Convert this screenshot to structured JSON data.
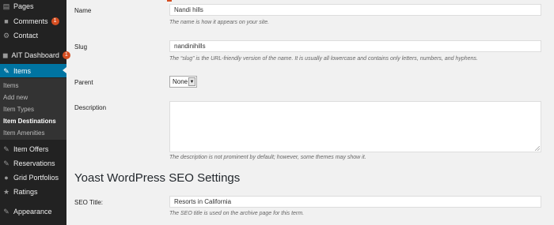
{
  "sidebar": {
    "items": [
      {
        "label": "Pages",
        "icon": "pages-icon"
      },
      {
        "label": "Comments",
        "icon": "comments-icon",
        "badge": "1"
      },
      {
        "label": "Contact",
        "icon": "contact-icon"
      },
      {
        "label": "AIT Dashboard",
        "icon": "ait-dashboard-icon",
        "badge": "1"
      },
      {
        "label": "Items",
        "icon": "items-icon",
        "active": true
      },
      {
        "label": "Item Offers",
        "icon": "item-offers-icon"
      },
      {
        "label": "Reservations",
        "icon": "reservations-icon"
      },
      {
        "label": "Grid Portfolios",
        "icon": "grid-portfolios-icon"
      },
      {
        "label": "Ratings",
        "icon": "ratings-icon"
      },
      {
        "label": "Appearance",
        "icon": "appearance-icon"
      }
    ],
    "submenu": [
      {
        "label": "Items"
      },
      {
        "label": "Add new"
      },
      {
        "label": "Item Types"
      },
      {
        "label": "Item Destinations",
        "current": true
      },
      {
        "label": "Item Amenities"
      }
    ]
  },
  "form": {
    "name": {
      "label": "Name",
      "value": "Nandi hills",
      "help": "The name is how it appears on your site."
    },
    "slug": {
      "label": "Slug",
      "value": "nandinihills",
      "help": "The “slug” is the URL-friendly version of the name. It is usually all lowercase and contains only letters, numbers, and hyphens."
    },
    "parent": {
      "label": "Parent",
      "selected": "None"
    },
    "description": {
      "label": "Description",
      "value": "",
      "help": "The description is not prominent by default; however, some themes may show it."
    },
    "section_title": "Yoast WordPress SEO Settings",
    "seo_title": {
      "label": "SEO Title:",
      "value": "Resorts in California",
      "help": "The SEO title is used on the archive page for this term."
    }
  },
  "colors": {
    "sidebar_bg": "#222222",
    "active_bg": "#0074a2",
    "badge": "#d54e21",
    "content_bg": "#f1f1f1"
  }
}
